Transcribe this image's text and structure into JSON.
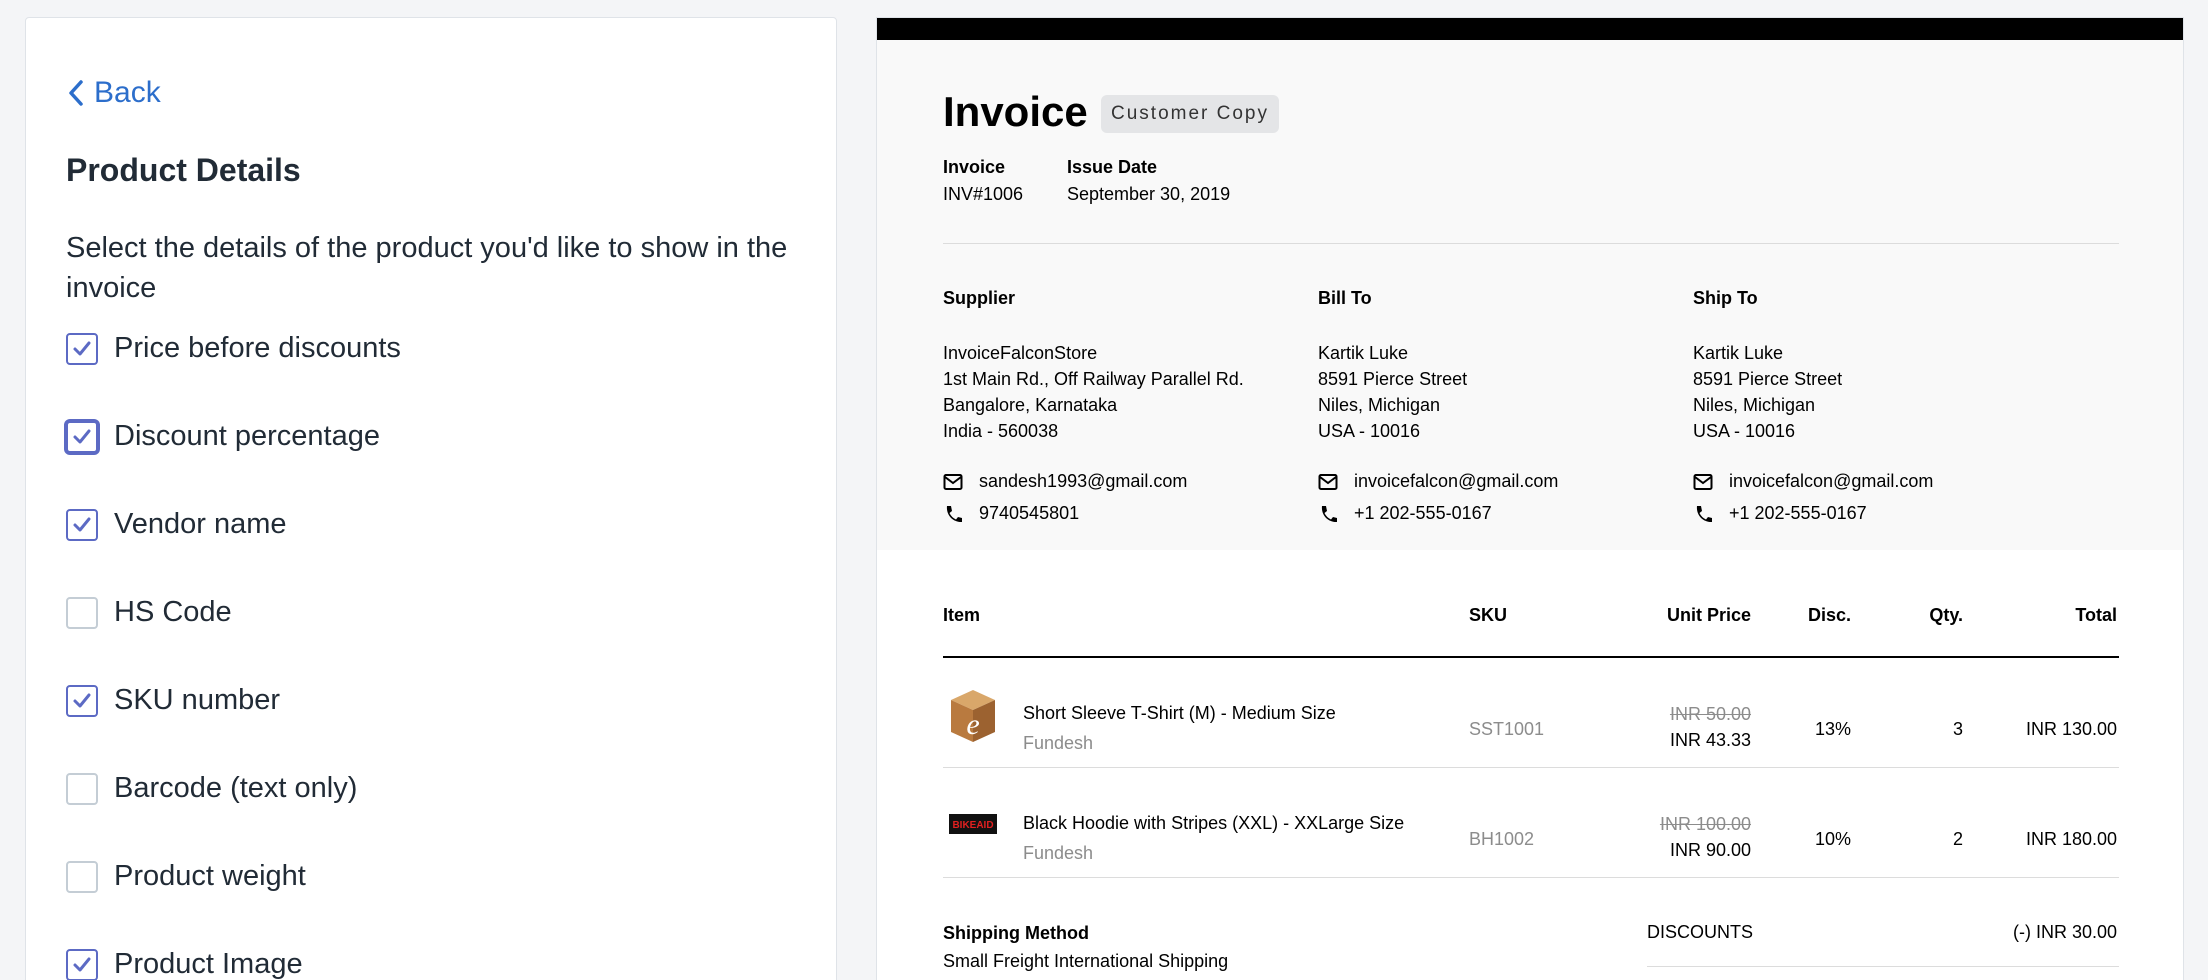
{
  "settings": {
    "back_label": "Back",
    "title": "Product Details",
    "description": "Select the details of the product you'd like to show in the invoice",
    "options": [
      {
        "label": "Price before discounts",
        "checked": true
      },
      {
        "label": "Discount percentage",
        "checked": true,
        "focused": true
      },
      {
        "label": "Vendor name",
        "checked": true
      },
      {
        "label": "HS Code",
        "checked": false
      },
      {
        "label": "SKU number",
        "checked": true
      },
      {
        "label": "Barcode (text only)",
        "checked": false
      },
      {
        "label": "Product weight",
        "checked": false
      },
      {
        "label": "Product Image",
        "checked": true
      }
    ]
  },
  "invoice": {
    "title": "Invoice",
    "copy_badge": "Customer Copy",
    "number_label": "Invoice",
    "number": "INV#1006",
    "date_label": "Issue Date",
    "date": "September 30, 2019",
    "supplier": {
      "title": "Supplier",
      "lines": [
        "InvoiceFalconStore",
        "1st Main Rd., Off Railway Parallel Rd.",
        "Bangalore, Karnataka",
        "India - 560038"
      ],
      "email": "sandesh1993@gmail.com",
      "phone": "9740545801"
    },
    "bill_to": {
      "title": "Bill To",
      "lines": [
        "Kartik Luke",
        "8591 Pierce Street",
        "Niles, Michigan",
        "USA - 10016"
      ],
      "email": "invoicefalcon@gmail.com",
      "phone": "+1 202-555-0167"
    },
    "ship_to": {
      "title": "Ship To",
      "lines": [
        "Kartik Luke",
        "8591 Pierce Street",
        "Niles, Michigan",
        "USA - 10016"
      ],
      "email": "invoicefalcon@gmail.com",
      "phone": "+1 202-555-0167"
    },
    "columns": {
      "item": "Item",
      "sku": "SKU",
      "unit_price": "Unit Price",
      "disc": "Disc.",
      "qty": "Qty.",
      "total": "Total"
    },
    "items": [
      {
        "name": "Short Sleeve T-Shirt (M) - Medium Size",
        "vendor": "Fundesh",
        "sku": "SST1001",
        "price_before": "INR 50.00",
        "price": "INR 43.33",
        "disc": "13%",
        "qty": "3",
        "total": "INR 130.00",
        "image_icon": "box-e-icon",
        "image_text": "e"
      },
      {
        "name": "Black Hoodie with Stripes (XXL) - XXLarge Size",
        "vendor": "Fundesh",
        "sku": "BH1002",
        "price_before": "INR 100.00",
        "price": "INR 90.00",
        "disc": "10%",
        "qty": "2",
        "total": "INR 180.00",
        "image_icon": "bikeaid-logo-icon",
        "image_text": "BIKEAID"
      }
    ],
    "shipping_method_label": "Shipping Method",
    "shipping_method": "Small Freight International Shipping",
    "discounts_label": "DISCOUNTS",
    "discounts_value": "(-) INR 30.00"
  },
  "colors": {
    "accent": "#5c6ac4",
    "link": "#2c6ecb",
    "muted": "#8c8c8c"
  }
}
